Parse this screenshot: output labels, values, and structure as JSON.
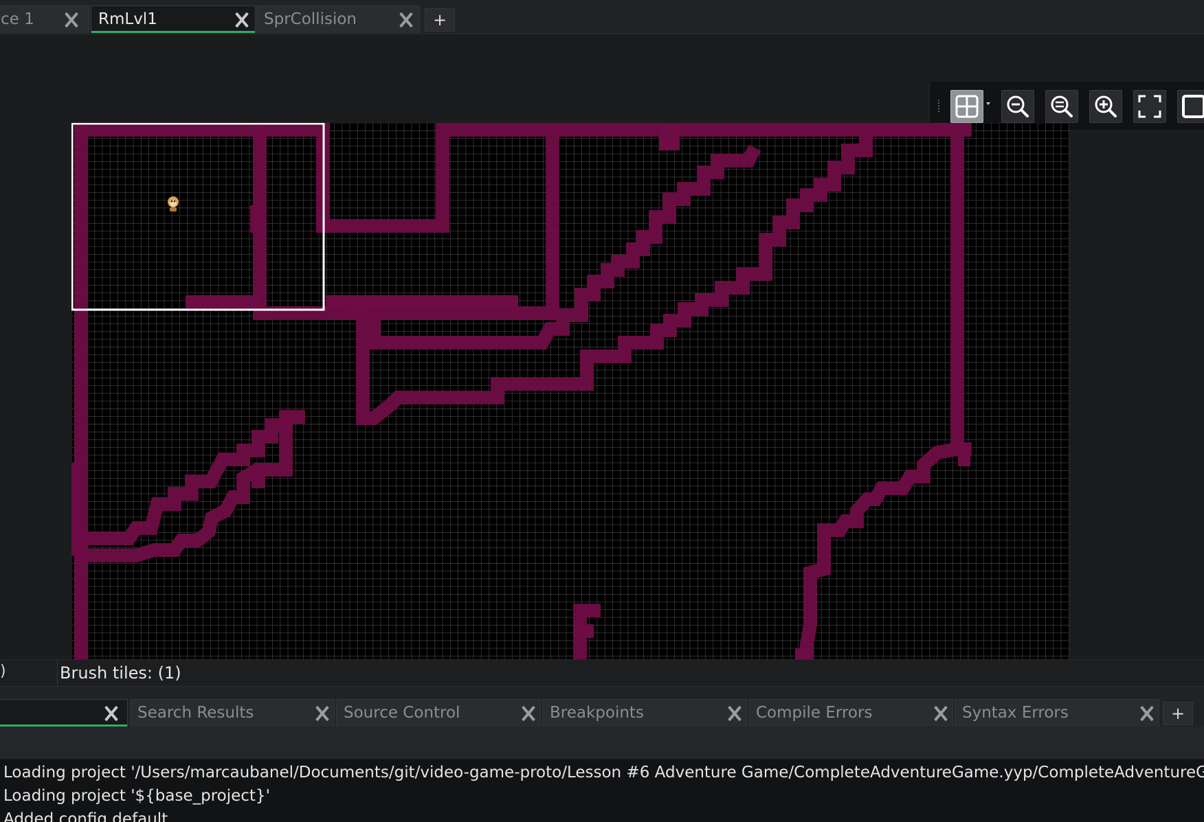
{
  "top_tabs": [
    {
      "label": "ce 1",
      "active": false
    },
    {
      "label": "RmLvl1",
      "active": true
    },
    {
      "label": "SprCollision",
      "active": false
    }
  ],
  "add_tab_label": "+",
  "toolbar": {
    "buttons": [
      {
        "name": "grid-toggle",
        "icon": "grid-icon",
        "active": true
      },
      {
        "name": "zoom-out",
        "icon": "zoom-out-icon"
      },
      {
        "name": "zoom-reset",
        "icon": "zoom-reset-icon"
      },
      {
        "name": "zoom-in",
        "icon": "zoom-in-icon"
      },
      {
        "name": "fit-to-screen",
        "icon": "fullscreen-icon"
      },
      {
        "name": "view-frame",
        "icon": "square-icon"
      }
    ]
  },
  "room": {
    "background_color": "#000000",
    "grid_color": "#3a3a3a",
    "tile_color": "#6e0d45",
    "view_outline_color": "#ffffff",
    "player_sprite": "monkey-sprite"
  },
  "status": {
    "left_fragment": ")",
    "brush_text": "Brush tiles: (1)"
  },
  "bottom_tabs": [
    {
      "label": "",
      "active": true
    },
    {
      "label": "Search Results"
    },
    {
      "label": "Source Control"
    },
    {
      "label": "Breakpoints"
    },
    {
      "label": "Compile Errors"
    },
    {
      "label": "Syntax Errors"
    }
  ],
  "output_lines": [
    "Loading project '/Users/marcaubanel/Documents/git/video-game-proto/Lesson #6 Adventure Game/CompleteAdventureGame.yyp/CompleteAdventureGame",
    "Loading project '${base_project}'",
    "Added config default"
  ]
}
